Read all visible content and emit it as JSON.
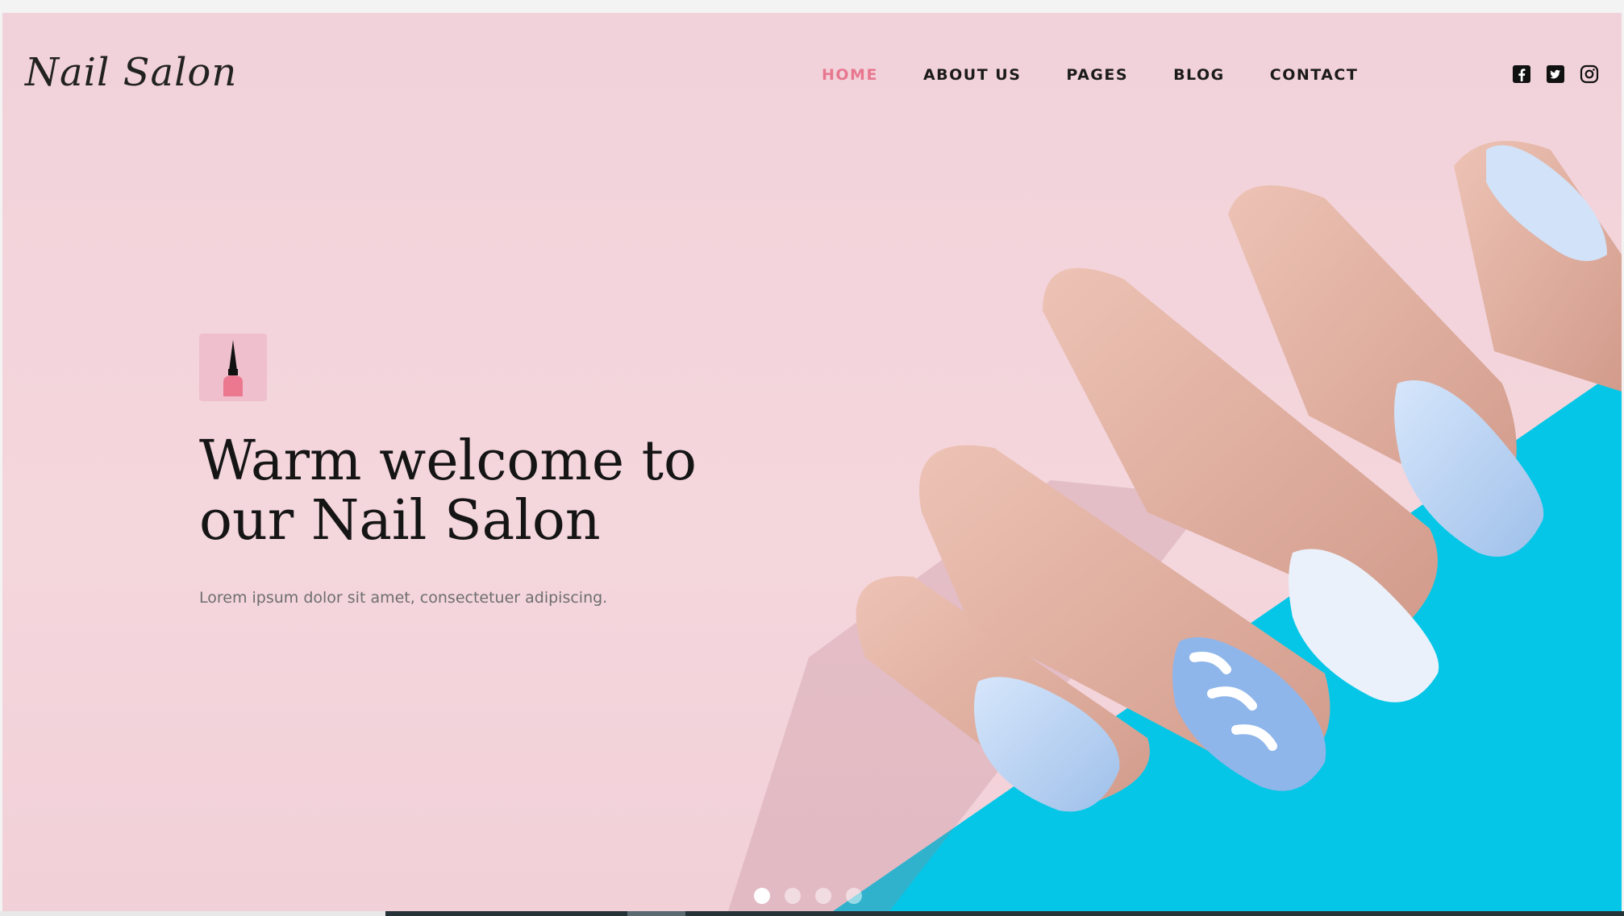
{
  "header": {
    "logo": "Nail Salon",
    "nav": [
      "HOME",
      "ABOUT US",
      "PAGES",
      "BLOG",
      "CONTACT"
    ],
    "active_nav": "HOME",
    "social_icons": [
      "facebook-icon",
      "twitter-icon",
      "instagram-icon"
    ]
  },
  "hero": {
    "icon": "nail-polish-icon",
    "title_line1": "Warm welcome to",
    "title_line2": "our Nail Salon",
    "subtitle": "Lorem ipsum dolor sit amet, consectetuer adipiscing.",
    "slides_total": 4,
    "active_slide": 1
  },
  "colors": {
    "accent": "#e7778f",
    "background_pink": "#f3d4db",
    "teal": "#05c8e8",
    "nail_blue": "#b8d2f2"
  }
}
